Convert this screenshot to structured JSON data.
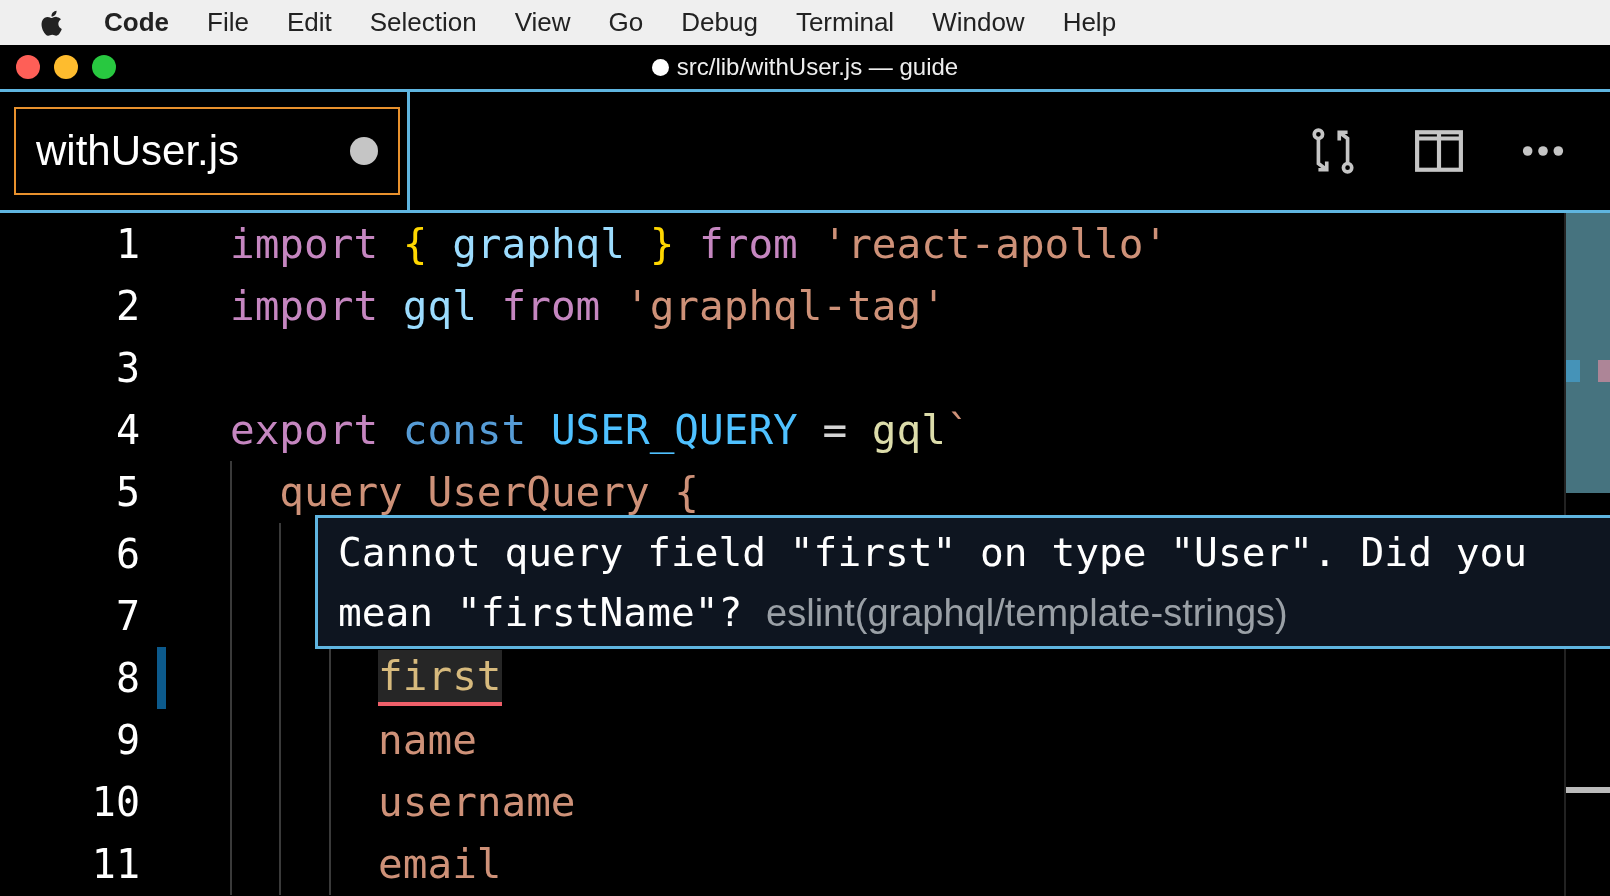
{
  "menu_bar": {
    "app": "Code",
    "items": [
      "File",
      "Edit",
      "Selection",
      "View",
      "Go",
      "Debug",
      "Terminal",
      "Window",
      "Help"
    ]
  },
  "window": {
    "title": "src/lib/withUser.js — guide",
    "modified": true
  },
  "tabs": [
    {
      "label": "withUser.js",
      "selected": true,
      "dirty": true
    }
  ],
  "editor": {
    "lines": [
      {
        "number": "1",
        "tokens": [
          {
            "text": "import ",
            "kind": "keyword"
          },
          {
            "text": "{ ",
            "kind": "bracket"
          },
          {
            "text": "graphql ",
            "kind": "variable"
          },
          {
            "text": "} ",
            "kind": "bracket"
          },
          {
            "text": "from ",
            "kind": "keyword"
          },
          {
            "text": "'react-apollo'",
            "kind": "string"
          }
        ]
      },
      {
        "number": "2",
        "tokens": [
          {
            "text": "import ",
            "kind": "keyword"
          },
          {
            "text": "gql ",
            "kind": "variable"
          },
          {
            "text": "from ",
            "kind": "keyword"
          },
          {
            "text": "'graphql-tag'",
            "kind": "string"
          }
        ]
      },
      {
        "number": "3"
      },
      {
        "number": "4",
        "tokens": [
          {
            "text": "export ",
            "kind": "keyword"
          },
          {
            "text": "const ",
            "kind": "storage"
          },
          {
            "text": "USER_QUERY ",
            "kind": "constant"
          },
          {
            "text": "= ",
            "kind": "operator"
          },
          {
            "text": "gql",
            "kind": "function"
          },
          {
            "text": "`",
            "kind": "string"
          }
        ],
        "children": [
          {
            "number": "5",
            "tokens": [
              {
                "text": "query UserQuery {",
                "kind": "string"
              }
            ],
            "children": [
              {
                "number": "6"
              },
              {
                "number": "7",
                "children": [
                  {
                    "number": "8",
                    "modified": true,
                    "tokens": [
                      {
                        "text": "first",
                        "kind": "field",
                        "error": true
                      }
                    ]
                  },
                  {
                    "number": "9",
                    "tokens": [
                      {
                        "text": "name",
                        "kind": "string"
                      }
                    ]
                  },
                  {
                    "number": "10",
                    "tokens": [
                      {
                        "text": "username",
                        "kind": "string"
                      }
                    ]
                  },
                  {
                    "number": "11",
                    "tokens": [
                      {
                        "text": "email",
                        "kind": "string"
                      }
                    ]
                  }
                ]
              }
            ]
          }
        ]
      }
    ],
    "minimap": {
      "level": 0.41
    }
  },
  "hover": {
    "message": "Cannot query field \"first\" on type \"User\". Did you mean \"firstName\"?",
    "source": "eslint(graphql/template-strings)"
  }
}
